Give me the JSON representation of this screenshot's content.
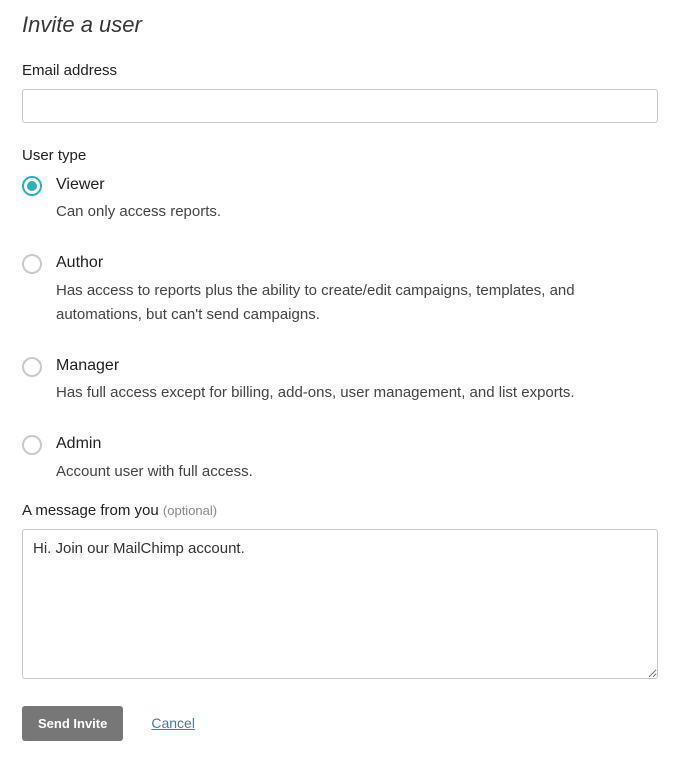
{
  "title": "Invite a user",
  "email": {
    "label": "Email address",
    "value": ""
  },
  "user_type": {
    "label": "User type",
    "selected": "viewer",
    "options": [
      {
        "key": "viewer",
        "title": "Viewer",
        "desc": "Can only access reports."
      },
      {
        "key": "author",
        "title": "Author",
        "desc": "Has access to reports plus the ability to create/edit campaigns, templates, and automations, but can't send campaigns."
      },
      {
        "key": "manager",
        "title": "Manager",
        "desc": "Has full access except for billing, add-ons, user management, and list exports."
      },
      {
        "key": "admin",
        "title": "Admin",
        "desc": "Account user with full access."
      }
    ]
  },
  "message": {
    "label_main": "A message from you ",
    "label_optional": "(optional)",
    "value": "Hi. Join our MailChimp account."
  },
  "actions": {
    "send": "Send Invite",
    "cancel": "Cancel"
  }
}
